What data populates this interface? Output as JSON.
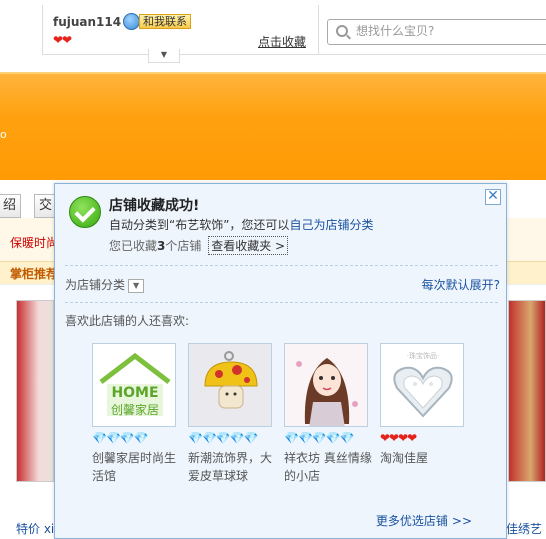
{
  "seller": {
    "name": "fujuan114",
    "contact_label": "和我联系",
    "rank_icons": "❤❤",
    "favorite_link": "点击收藏"
  },
  "search": {
    "placeholder": "想找什么宝贝?"
  },
  "background": {
    "banner_fragment": "o",
    "nav_tabs": [
      "绍",
      "交"
    ],
    "subnav_text": "保暖时尚",
    "recommend_label": "掌柜推荐",
    "bottom_left_text": "特价 xi",
    "bottom_right_text": "佳绣艺舍"
  },
  "popup": {
    "title": "店铺收藏成功!",
    "auto_prefix": "自动分类到“布艺软饰”，您还可以",
    "auto_link": "自己为店铺分类",
    "count_prefix": "您已收藏",
    "count": "3",
    "count_suffix": "个店铺",
    "view_favorites": "查看收藏夹 >",
    "classify_label": "为店铺分类",
    "expand_link": "每次默认展开?",
    "also_like": "喜欢此店铺的人还喜欢:",
    "more_link": "更多优选店铺",
    "more_arrow": ">>",
    "close_glyph": "✕"
  },
  "shops": [
    {
      "name": "创馨家居时尚生活馆",
      "rank": "💎💎💎💎",
      "rank_type": "diamond",
      "image_caption": "HOME 创馨家居"
    },
    {
      "name": "新潮流饰界，大爱皮草球球",
      "rank": "💎💎💎💎💎",
      "rank_type": "diamond",
      "image_caption": ""
    },
    {
      "name": "祥衣坊 真丝情缘的小店",
      "rank": "💎💎💎💎💎",
      "rank_type": "diamond",
      "image_caption": ""
    },
    {
      "name": "淘淘佳屋",
      "rank": "❤❤❤❤",
      "rank_type": "heart",
      "image_caption": "jewelry"
    }
  ],
  "colors": {
    "accent_orange": "#ff9b04",
    "link_blue": "#1a52a0",
    "popup_bg": "#eef5fd",
    "success_green": "#38a80f"
  }
}
